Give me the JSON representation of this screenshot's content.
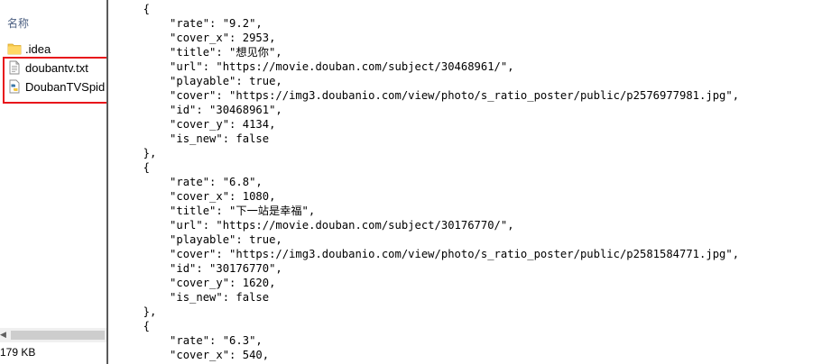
{
  "explorer": {
    "column_header": "名称",
    "items": [
      {
        "name": ".idea",
        "icon": "folder-icon"
      },
      {
        "name": "doubantv.txt",
        "icon": "text-file-icon"
      },
      {
        "name": "DoubanTVSpid",
        "icon": "python-file-icon"
      }
    ],
    "status_text": "179 KB",
    "highlight_color": "#e8141b"
  },
  "editor": {
    "lines": [
      "  {",
      "      \"rate\": \"9.2\",",
      "      \"cover_x\": 2953,",
      "      \"title\": \"想见你\",",
      "      \"url\": \"https://movie.douban.com/subject/30468961/\",",
      "      \"playable\": true,",
      "      \"cover\": \"https://img3.doubanio.com/view/photo/s_ratio_poster/public/p2576977981.jpg\",",
      "      \"id\": \"30468961\",",
      "      \"cover_y\": 4134,",
      "      \"is_new\": false",
      "  },",
      "  {",
      "      \"rate\": \"6.8\",",
      "      \"cover_x\": 1080,",
      "      \"title\": \"下一站是幸福\",",
      "      \"url\": \"https://movie.douban.com/subject/30176770/\",",
      "      \"playable\": true,",
      "      \"cover\": \"https://img3.doubanio.com/view/photo/s_ratio_poster/public/p2581584771.jpg\",",
      "      \"id\": \"30176770\",",
      "      \"cover_y\": 1620,",
      "      \"is_new\": false",
      "  },",
      "  {",
      "      \"rate\": \"6.3\",",
      "      \"cover_x\": 540,"
    ]
  }
}
